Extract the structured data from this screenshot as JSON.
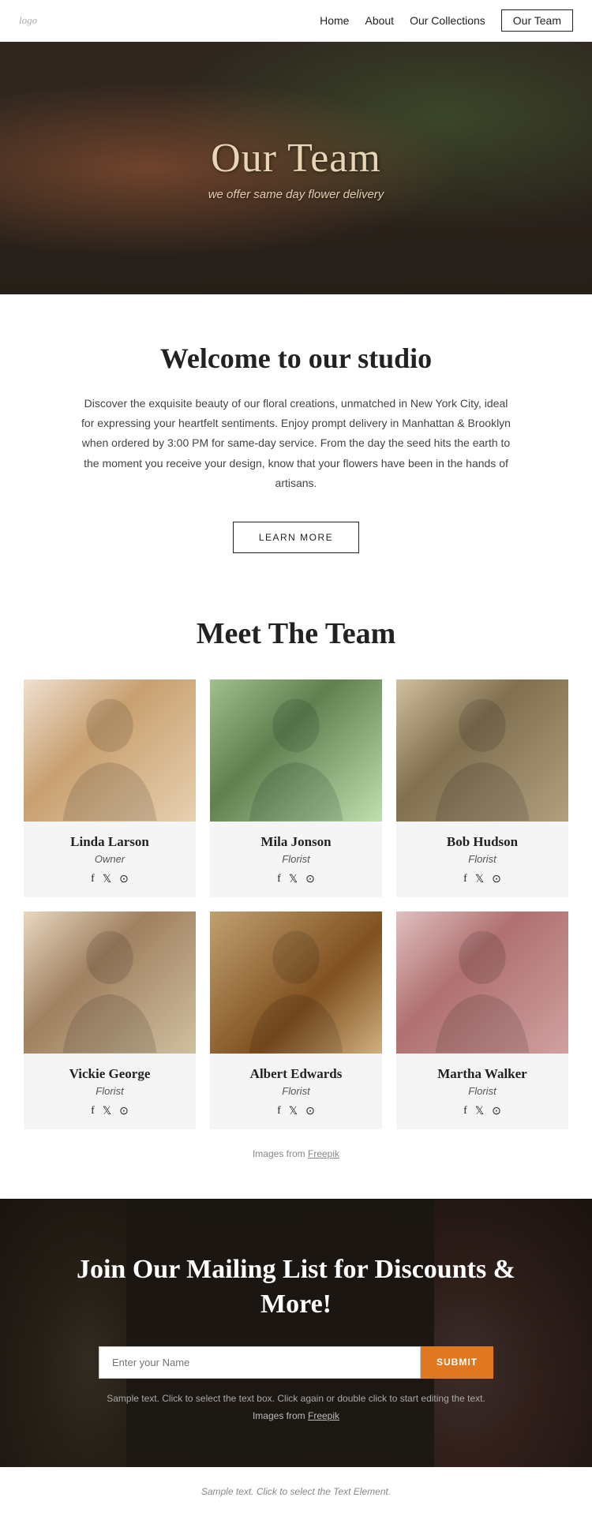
{
  "nav": {
    "logo": "logo",
    "links": [
      {
        "id": "home",
        "label": "Home",
        "active": false
      },
      {
        "id": "about",
        "label": "About",
        "active": false
      },
      {
        "id": "collections",
        "label": "Our Collections",
        "active": false
      },
      {
        "id": "team",
        "label": "Our Team",
        "active": true
      }
    ]
  },
  "hero": {
    "title": "Our Team",
    "subtitle": "we offer same day flower delivery"
  },
  "welcome": {
    "title": "Welcome to our studio",
    "body": "Discover the exquisite beauty of our floral creations, unmatched in New York City, ideal for expressing your heartfelt sentiments. Enjoy prompt delivery in Manhattan & Brooklyn when ordered by 3:00 PM for same-day service.  From the day the seed hits the earth to the moment you receive your design, know that your flowers have been in the hands of artisans.",
    "button_label": "LEARN MORE"
  },
  "team": {
    "title": "Meet The Team",
    "members": [
      {
        "id": "linda",
        "name": "Linda Larson",
        "role": "Owner",
        "img_class": "img-linda"
      },
      {
        "id": "mila",
        "name": "Mila Jonson",
        "role": "Florist",
        "img_class": "img-mila"
      },
      {
        "id": "bob",
        "name": "Bob Hudson",
        "role": "Florist",
        "img_class": "img-bob"
      },
      {
        "id": "vickie",
        "name": "Vickie George",
        "role": "Florist",
        "img_class": "img-vickie"
      },
      {
        "id": "albert",
        "name": "Albert Edwards",
        "role": "Florist",
        "img_class": "img-albert"
      },
      {
        "id": "martha",
        "name": "Martha Walker",
        "role": "Florist",
        "img_class": "img-martha"
      }
    ],
    "images_from_text": "Images from ",
    "images_from_link": "Freepik"
  },
  "mailing": {
    "title": "Join Our Mailing List for Discounts & More!",
    "input_placeholder": "Enter your Name",
    "submit_label": "SUBMIT",
    "sample_text": "Sample text. Click to select the text box. Click again or double click to start editing the text.",
    "images_from_text": "Images from ",
    "images_from_link": "Freepik"
  },
  "footer": {
    "text": "Sample text. Click to select the Text Element."
  },
  "socials": {
    "facebook": "f",
    "twitter": "𝕏",
    "instagram": "⊙"
  }
}
